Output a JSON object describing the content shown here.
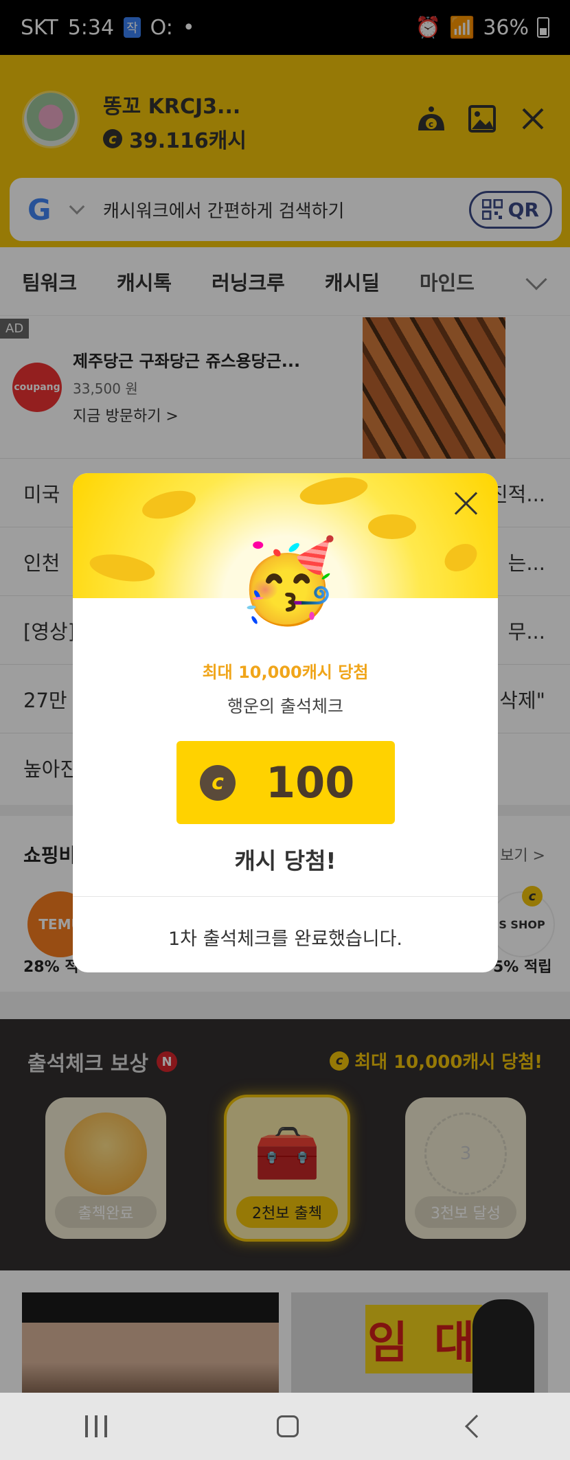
{
  "status_bar": {
    "carrier": "SKT",
    "time": "5:34",
    "badge": "작",
    "extra": "O:",
    "battery": "36%"
  },
  "header": {
    "username": "똥꼬 KRCJ3...",
    "cash": "39.116캐시"
  },
  "search": {
    "google": "G",
    "placeholder": "캐시워크에서 간편하게 검색하기",
    "qr_label": "QR"
  },
  "tabs": [
    "팀워크",
    "캐시톡",
    "러닝크루",
    "캐시딜",
    "마인드"
  ],
  "ad": {
    "tag": "AD",
    "brand": "coupang",
    "title": "제주당근 구좌당근 쥬스용당근...",
    "price": "33,500 원",
    "cta": "지금 방문하기 >"
  },
  "news": [
    {
      "head": "미국 ",
      "tail": "진적..."
    },
    {
      "head": "인천 ",
      "tail": "는..."
    },
    {
      "head": "[영상]",
      "tail": "무..."
    },
    {
      "head": "27만 ",
      "tail": "삭제\""
    },
    {
      "head": "높아진",
      "tail": ""
    }
  ],
  "shopping": {
    "title": "쇼핑비",
    "more": "보기 >",
    "left_brand": "TEMU",
    "left_rate": "28% 적",
    "right_brand": "S SHOP",
    "right_rate": "5% 적립"
  },
  "attendance": {
    "title": "출석체크 보상",
    "new_badge": "N",
    "max_reward": "최대 10,000캐시 당첨!",
    "cards": [
      {
        "label": "출첵완료"
      },
      {
        "label": "2천보 출첵"
      },
      {
        "label": "3천보 달성",
        "step": "3"
      }
    ]
  },
  "modal": {
    "emoji": "🥳",
    "max_reward": "최대 10,000캐시 당첨",
    "subtitle": "행운의 출석체크",
    "coin_symbol": "c",
    "amount": "100",
    "win_text": "캐시 당첨!",
    "done_text": "1차 출석체크를 완료했습니다."
  },
  "photo2_sign": "임 대"
}
